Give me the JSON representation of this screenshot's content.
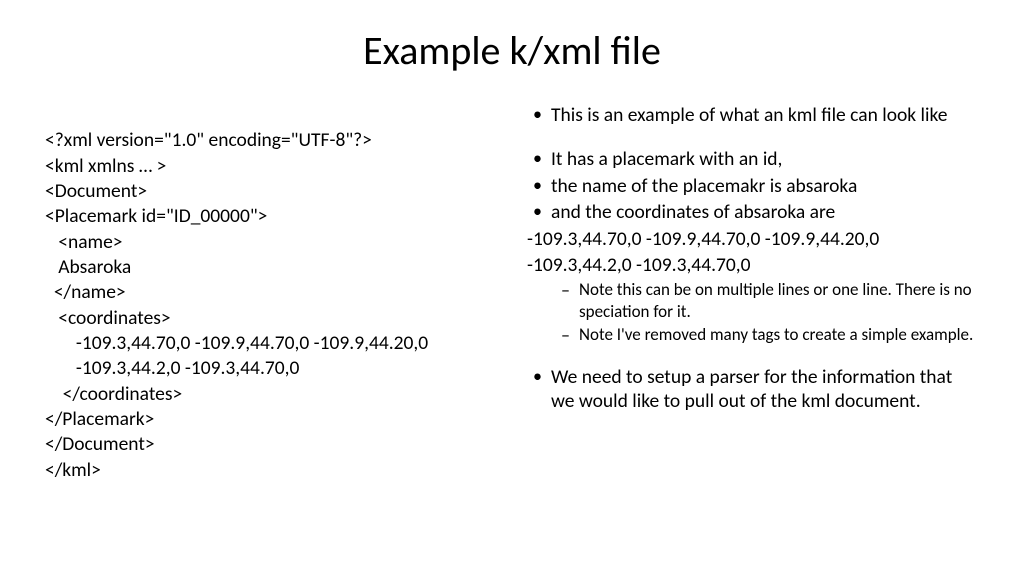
{
  "title": "Example k/xml file",
  "left": {
    "l1": "<?xml version=\"1.0\" encoding=\"UTF-8\"?>",
    "l2": "<kml xmlns … >",
    "l3": "<Document>",
    "l4": "<Placemark id=\"ID_00000\">",
    "l5": "   <name>",
    "l6": "   Absaroka",
    "l7": "  </name>",
    "l8": "   <coordinates>",
    "l9": "       -109.3,44.70,0 -109.9,44.70,0 -109.9,44.20,0",
    "l10": "       -109.3,44.2,0 -109.3,44.70,0",
    "l11": "    </coordinates>",
    "l12": "</Placemark>",
    "l13": "</Document>",
    "l14": "</kml>"
  },
  "right": {
    "b1": "This is an example of what an kml file can look like",
    "b2": "It has a placemark with an id,",
    "b3": "the name of the placemakr is absaroka",
    "b4": "and the coordinates of absaroka are",
    "c1": "-109.3,44.70,0 -109.9,44.70,0 -109.9,44.20,0",
    "c2": "-109.3,44.2,0 -109.3,44.70,0",
    "s1": "Note this can be on multiple lines or one line. There is no speciation for it.",
    "s2": "Note I've removed many tags to create a simple example.",
    "b5": "We need to setup a parser for the information that we would like to pull out of the kml document."
  }
}
